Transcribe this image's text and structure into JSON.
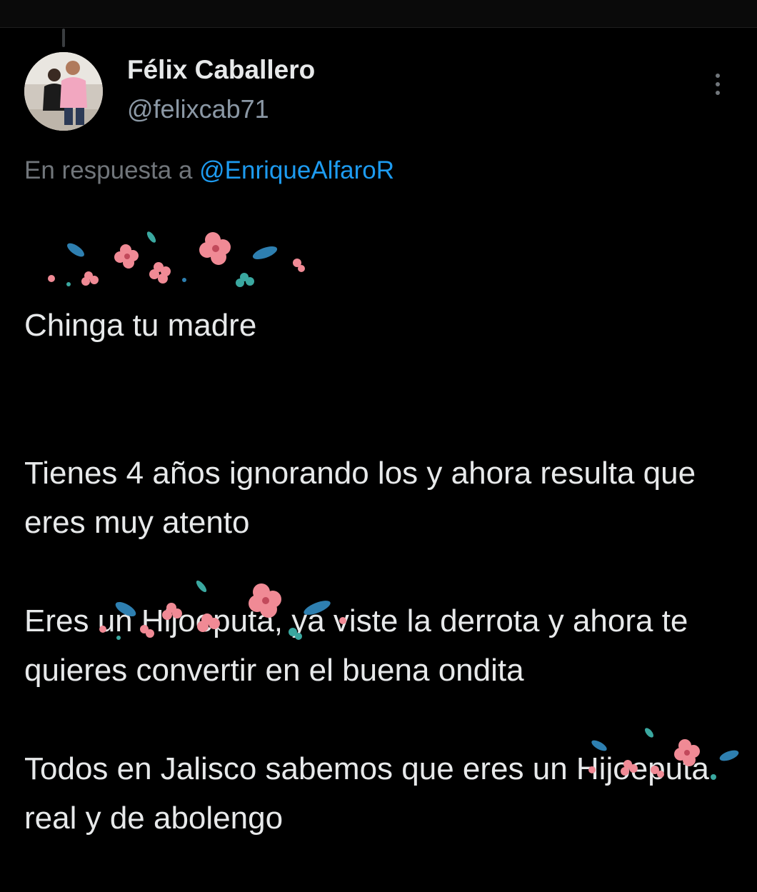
{
  "author": {
    "display_name": "Félix Caballero",
    "handle": "@felixcab71"
  },
  "reply_context": {
    "prefix": "En respuesta a ",
    "mention": "@EnriqueAlfaroR"
  },
  "tweet": {
    "p1_text": "Chinga tu madre",
    "p2_text": "Tienes 4 años ignorando los y ahora resulta que eres muy atento",
    "p3_censored": "Eres un Hijoeputa,",
    "p3_rest": " ya viste la derrota y ahora te quieres convertir en el buena ondita",
    "p4_lead": "Todos en Jalisco sabemos que eres un ",
    "p4_censored": "Hijoeputa",
    "p4_rest": " real y de abolengo"
  },
  "icons": {
    "more": "more-vertical-icon",
    "censor": "flower-sticker-icon"
  },
  "colors": {
    "background": "#000000",
    "text": "#e7e9ea",
    "secondary": "#71767b",
    "link": "#1d9bf0",
    "flower_pink": "#f08a95",
    "leaf_blue": "#2e7fb0",
    "leaf_teal": "#3aa8a0"
  }
}
